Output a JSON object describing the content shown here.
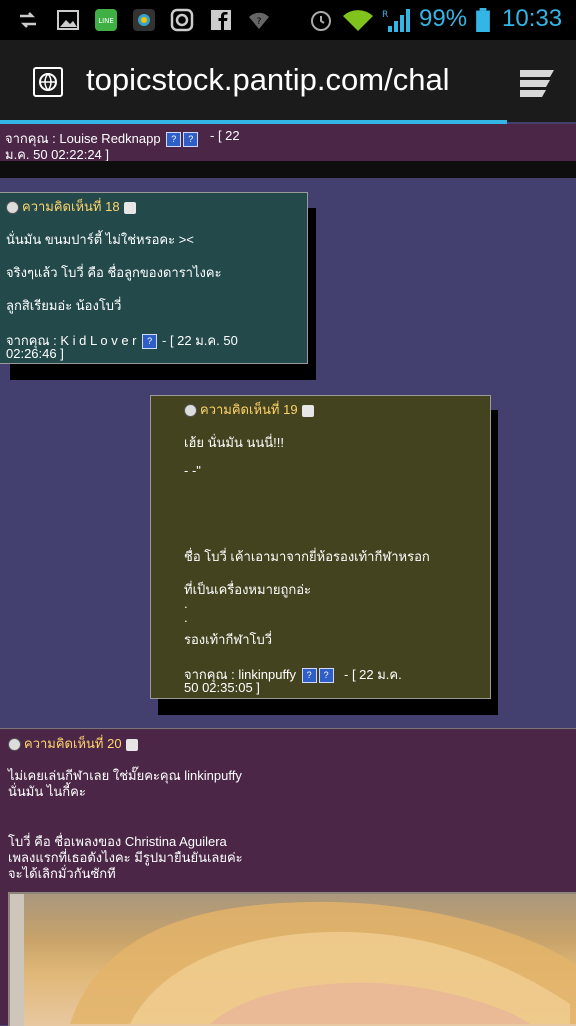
{
  "status_bar": {
    "battery": "99%",
    "time": "10:33"
  },
  "browser": {
    "url": "topicstock.pantip.com/chal",
    "progress": 0.88
  },
  "comment_17_footer": {
    "from": "จากคุณ : Louise Redknapp",
    "date": "- [ 22 ม.ค. 50 02:22:24 ]"
  },
  "comment_18": {
    "header": "ความคิดเห็นที่ 18",
    "lines": [
      "นั่นมัน ขนมปาร์ตี้ ไม่ใช่หรอคะ ><",
      "จริงๆแล้ว โบวี่ คือ ชื่อลูกของดาราไงคะ",
      "ลูกสิเรียมอ่ะ น้องโบวี่"
    ],
    "from": "จากคุณ : K i d L o v e r",
    "date": "- [ 22 ม.ค. 50 02:26:46 ]"
  },
  "comment_19": {
    "header": "ความคิดเห็นที่ 19",
    "lines": [
      "เฮ้ย นั่นมัน นนนี่!!!",
      "- -\"",
      "ชื่อ โบวี่ เค้าเอามาจากยี่ห้อรองเท้ากีฬาหรอก",
      "ที่เป็นเครื่องหมายถูกอ่ะ",
      ".",
      ".",
      "รองเท้ากีฬาโบวี่"
    ],
    "from": "จากคุณ : linkinpuffy",
    "date": "- [ 22 ม.ค. 50 02:35:05 ]"
  },
  "comment_20": {
    "header": "ความคิดเห็นที่ 20",
    "lines": [
      "ไม่เคยเล่นกีฬาเลย ใช่มั๊ยคะคุณ linkinpuffy",
      "นั่นมัน ไนกี้คะ",
      "โบวี่ คือ ชื่อเพลงของ Christina Aguilera",
      "เพลงแรกที่เธอดังไงคะ มีรูปมายืนยันเลยค่ะ",
      "จะได้เลิกมั่วกันซักที"
    ]
  },
  "colors": {
    "page_bg": "#433f6f",
    "box18_bg": "#23494b",
    "box19_bg": "#43431f",
    "strip_bg": "#4b2647",
    "header_text": "#ffd56b",
    "accent": "#33b5e5"
  }
}
